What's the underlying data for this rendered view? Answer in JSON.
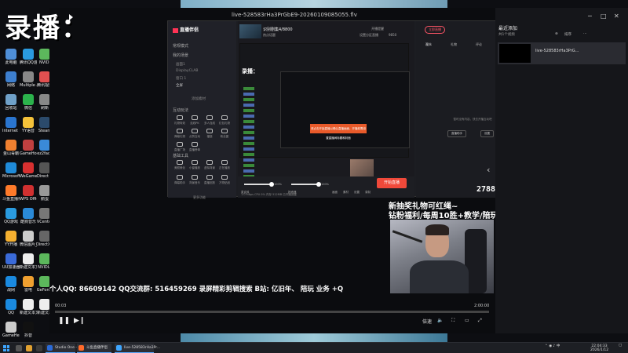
{
  "overlay_text": "录播：",
  "player": {
    "title": "live-528583rHa3PrGbE9-20260109085055.flv",
    "time_current": "00:03",
    "time_total": "2:00:00",
    "speed_label": "倍速",
    "progress": 0.0
  },
  "desktop_icons": [
    {
      "label": "此电脑",
      "color": "#4f8fd8"
    },
    {
      "label": "腾讯QQ游",
      "color": "#2a9be0"
    },
    {
      "label": "NVIDI",
      "color": "#5cb85c"
    },
    {
      "label": "网络",
      "color": "#3d7fcf"
    },
    {
      "label": "Multiple Ac",
      "color": "#888"
    },
    {
      "label": "腾讯视频",
      "color": "#e05050"
    },
    {
      "label": "回收站",
      "color": "#6fa0c8"
    },
    {
      "label": "微信",
      "color": "#2bb24c"
    },
    {
      "label": "刷新",
      "color": "#888"
    },
    {
      "label": "Internet Explorer",
      "color": "#2a75d0"
    },
    {
      "label": "YY语音",
      "color": "#f5c23a"
    },
    {
      "label": "Steam",
      "color": "#2b4a6b"
    },
    {
      "label": "金山毒霸",
      "color": "#f08030"
    },
    {
      "label": "GameHo...",
      "color": "#c04040"
    },
    {
      "label": "ez2face",
      "color": "#3a8ad8"
    },
    {
      "label": "Microsoft Edge",
      "color": "#1f8ad8"
    },
    {
      "label": "WeGame",
      "color": "#d83030"
    },
    {
      "label": "Direct X",
      "color": "#555"
    },
    {
      "label": "斗鱼直播伴侣",
      "color": "#ff7a2a"
    },
    {
      "label": "WPS Office",
      "color": "#d03030"
    },
    {
      "label": "鹅蛋",
      "color": "#999"
    },
    {
      "label": "QQ游戏",
      "color": "#2a9be0"
    },
    {
      "label": "酷狗音乐",
      "color": "#2a8ad8"
    },
    {
      "label": "VCenter",
      "color": "#777"
    },
    {
      "label": "YY开播",
      "color": "#f5b030"
    },
    {
      "label": "微信图片_20260111...",
      "color": "#ccc"
    },
    {
      "label": "DirectX 修复工具",
      "color": "#666"
    },
    {
      "label": "UU加速器",
      "color": "#3a6ad8"
    },
    {
      "label": "新建文本文档",
      "color": "#eee"
    },
    {
      "label": "NVIDIA",
      "color": "#5cb85c"
    },
    {
      "label": "战网",
      "color": "#1a8ae0"
    },
    {
      "label": "雷电",
      "color": "#f0a030"
    },
    {
      "label": "GeForce",
      "color": "#5cb85c"
    },
    {
      "label": "QQ",
      "color": "#1a8ae0"
    },
    {
      "label": "新建文本文档 (2)",
      "color": "#eee"
    },
    {
      "label": "新建文本",
      "color": "#eee"
    },
    {
      "label": "GameHe...",
      "color": "#ccc"
    },
    {
      "label": "抖音",
      "color": "#111"
    }
  ],
  "app": {
    "logo_text": "直播伴侣",
    "scene_label": "常规模式",
    "scene_section": "我的场景",
    "scenes": [
      "画面1",
      "DisplayCLAB",
      "窗口 1",
      "全屏"
    ],
    "add_source": "添加素材",
    "interactive_label": "互动玩法",
    "interactive_tools": [
      "礼物特效",
      "连线PK",
      "多人连线",
      "红包礼物",
      "弹幕礼物",
      "点赞互动",
      "福袋",
      "粉丝团",
      "直播广场",
      "直播榜单"
    ],
    "tools_label": "基础工具",
    "tools": [
      "美颜美化",
      "小窗播放",
      "虚拟背景",
      "正在播放",
      "弹幕助手",
      "背景音乐",
      "直播回放",
      "万物贴纸"
    ],
    "more_tools": "更多功能",
    "stream_title": "识别剧集4/8800",
    "stream_tag": "热点话题",
    "stream_meta": [
      "开播提醒",
      "设置分区直播",
      "观看人数",
      "9850"
    ],
    "preview_label": "录播：",
    "popup_text": "请点击开始直播以确认直播画面，开播前需设置直播间标题和封面",
    "mic_label": "麦克风",
    "mic_value": "100%",
    "speaker_label": "扬声器",
    "speaker_value": "100%",
    "ctrl_icons": [
      "画面",
      "素材",
      "设置",
      "录制"
    ],
    "start_live": "开始直播",
    "status_line": "1.0 Mbps  CPU  0%  内存 512MB  已开播提醒",
    "right_btn": "立即直播",
    "right_tabs": [
      "观众",
      "礼物",
      "评论",
      "弹幕"
    ],
    "empty_tip": "暂时没有内容，快去开播互动吧",
    "right_buttons": [
      "直播助手",
      "设置"
    ]
  },
  "video_overlay": {
    "ticker_num": "2788",
    "promo_line1": "新抽奖礼物可红绳~",
    "promo_line2": "钻粉福利/每周10胜+教学/陪玩",
    "bottom_ticker": "个人QQ: 86609142   QQ交流群: 516459269   录屏精彩剪辑搜索 B站: 亿旧年、  陪玩 业务 +Q"
  },
  "right_panel": {
    "title": "最近添加",
    "subtitle": "共1个视频",
    "order": "排序",
    "item_name": "live-528583rHa3PrG..."
  },
  "taskbar": {
    "apps": [
      "Studio One - 10",
      "斗鱼直播伴侣",
      "live-528583rHa3Pr..."
    ],
    "time": "22:04:33",
    "date": "2026/1/12"
  }
}
